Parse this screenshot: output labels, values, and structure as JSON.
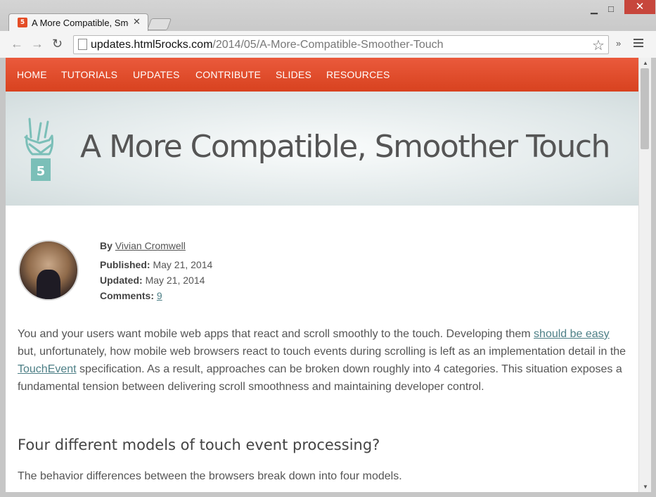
{
  "browser": {
    "tab_title": "A More Compatible, Smoothe",
    "tab_favicon": "5",
    "url_host": "updates.html5rocks.com",
    "url_path": "/2014/05/A-More-Compatible-Smoother-Touch"
  },
  "site": {
    "nav": [
      "HOME",
      "TUTORIALS",
      "UPDATES",
      "CONTRIBUTE",
      "SLIDES",
      "RESOURCES"
    ],
    "title": "A More Compatible, Smoother Touch"
  },
  "author": {
    "by_label": "By",
    "name": "Vivian Cromwell",
    "published_label": "Published:",
    "published": "May 21, 2014",
    "updated_label": "Updated:",
    "updated": "May 21, 2014",
    "comments_label": "Comments:",
    "comments": "9"
  },
  "article": {
    "p1_a": "You and your users want mobile web apps that react and scroll smoothly to the touch. Developing them ",
    "p1_link1": "should be easy",
    "p1_b": " but, unfortunately, how mobile web browsers react to touch events during scrolling is left as an implementation detail in the ",
    "p1_link2": "TouchEvent",
    "p1_c": " specification. As a result, approaches can be broken down roughly into 4 categories. This situation exposes a fundamental tension between delivering scroll smoothness and maintaining developer control.",
    "h2": "Four different models of touch event processing?",
    "p2": "The behavior differences between the browsers break down into four models."
  },
  "colors": {
    "nav_bg": "#e04b2a",
    "link": "#4d7f86",
    "logo": "#7bbfb8"
  },
  "icons": [
    "html5-favicon-icon",
    "back-icon",
    "forward-icon",
    "reload-icon",
    "page-icon",
    "star-icon",
    "menu-icon",
    "html5-rocks-logo-icon"
  ]
}
